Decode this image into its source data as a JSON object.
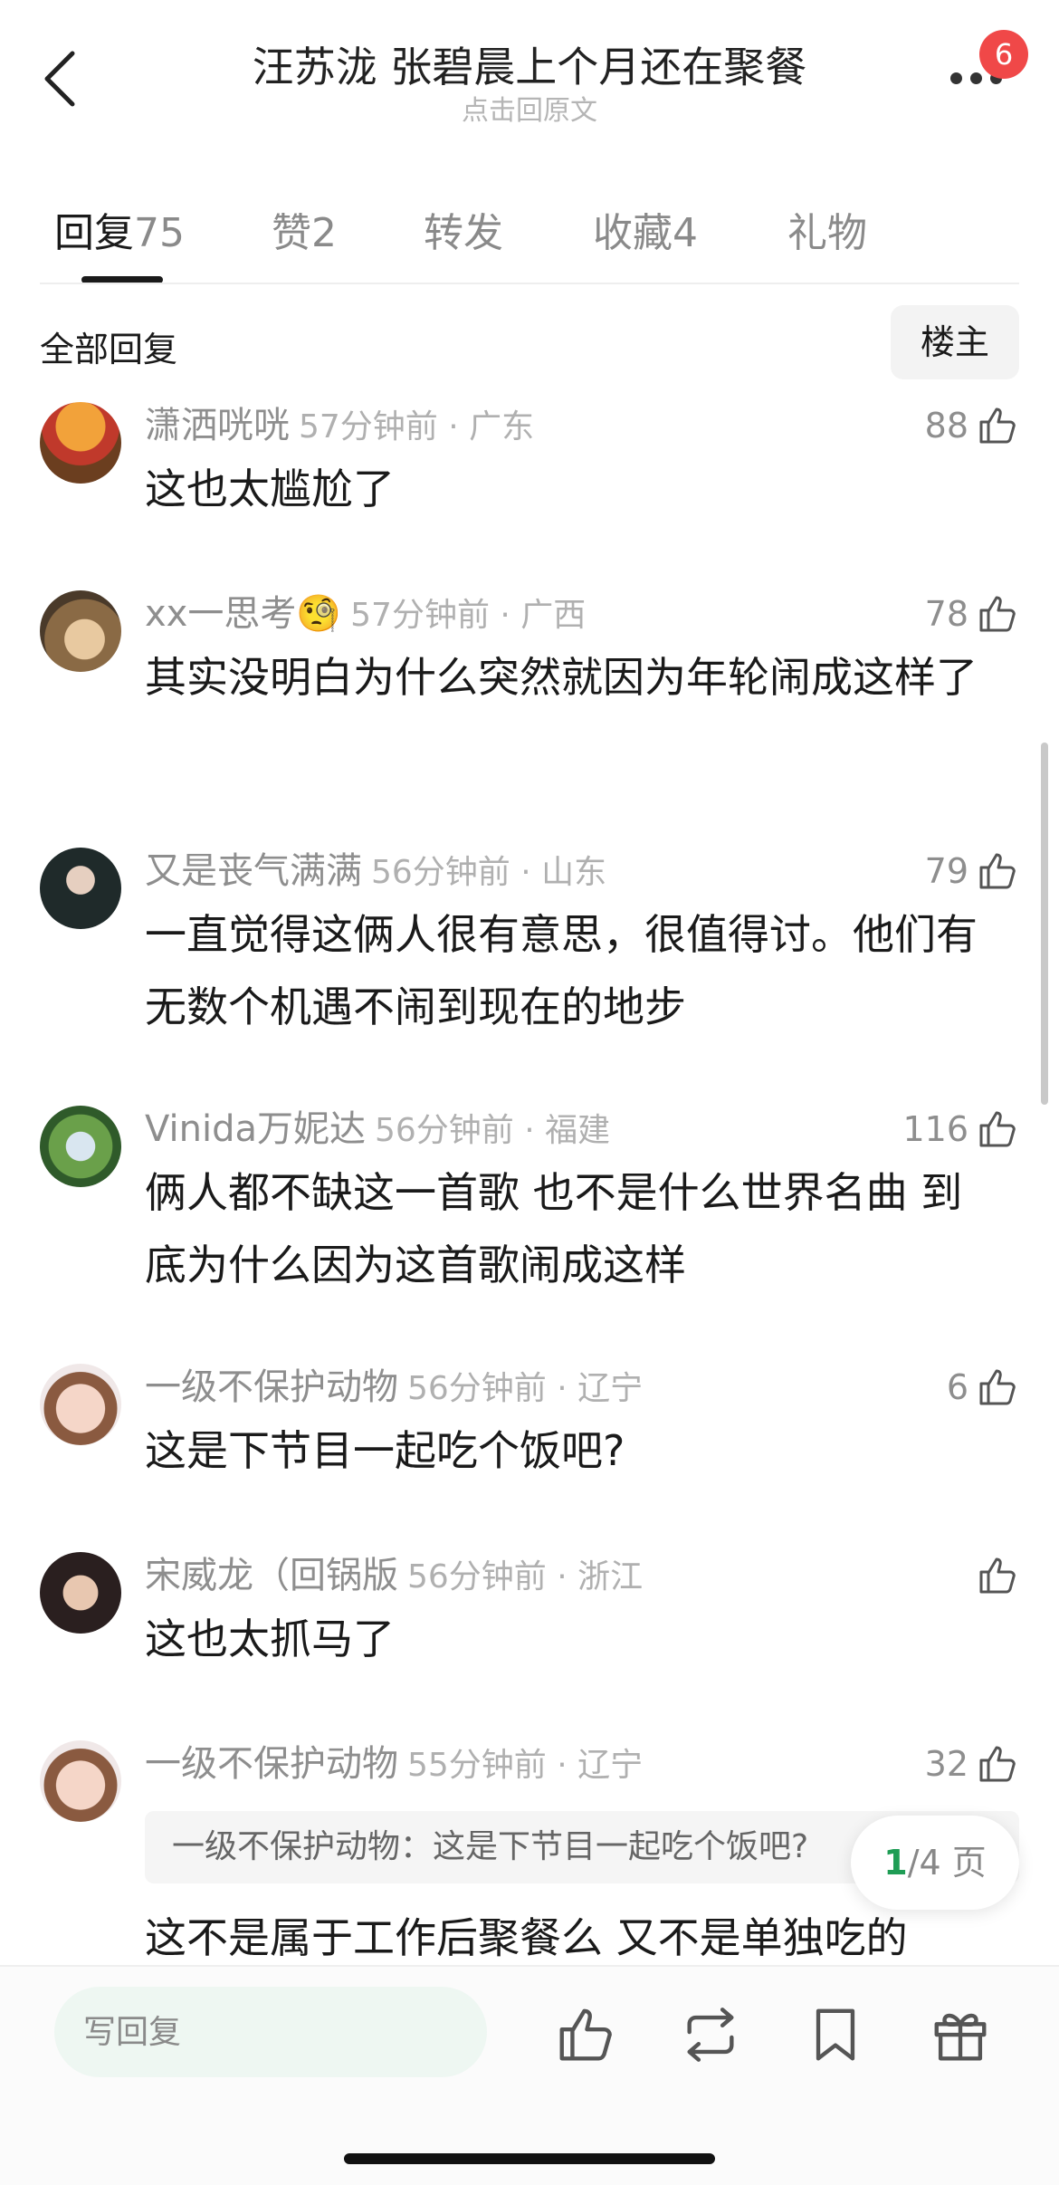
{
  "header": {
    "title": "汪苏泷 张碧晨上个月还在聚餐",
    "subtitle": "点击回原文",
    "notification_count": "6"
  },
  "tabs": [
    {
      "label": "回复",
      "count": "75"
    },
    {
      "label": "赞",
      "count": "2"
    },
    {
      "label": "转发",
      "count": ""
    },
    {
      "label": "收藏",
      "count": "4"
    },
    {
      "label": "礼物",
      "count": ""
    }
  ],
  "section": {
    "title": "全部回复",
    "floor_button": "楼主"
  },
  "comments": [
    {
      "name": "潇洒咣咣",
      "time": "57分钟前 · 广东",
      "likes": "88",
      "text": "这也太尴尬了"
    },
    {
      "name": "xx一思考🧐",
      "time": "57分钟前 · 广西",
      "likes": "78",
      "text": "其实没明白为什么突然就因为年轮闹成这样了"
    },
    {
      "name": "又是丧气满满",
      "time": "56分钟前 · 山东",
      "likes": "79",
      "text": "一直觉得这俩人很有意思，很值得讨。他们有无数个机遇不闹到现在的地步"
    },
    {
      "name": "Vinida万妮达",
      "time": "56分钟前 · 福建",
      "likes": "116",
      "text": "俩人都不缺这一首歌 也不是什么世界名曲 到底为什么因为这首歌闹成这样"
    },
    {
      "name": "一级不保护动物",
      "time": "56分钟前 · 辽宁",
      "likes": "6",
      "text": "这是下节目一起吃个饭吧?"
    },
    {
      "name": "宋威龙（回锅版",
      "time": "56分钟前 · 浙江",
      "likes": "",
      "text": "这也太抓马了"
    },
    {
      "name": "一级不保护动物",
      "time": "55分钟前 · 辽宁",
      "likes": "32",
      "quote": "一级不保护动物：这是下节目一起吃个饭吧?",
      "text": "这不是属于工作后聚餐么  又不是单独吃的"
    }
  ],
  "pagination": {
    "current": "1",
    "total": "/4 页"
  },
  "bottom": {
    "reply_placeholder": "写回复"
  },
  "colors": {
    "accent": "#1f9d55",
    "badge": "#f04848",
    "input_bg": "#eef7f2"
  }
}
